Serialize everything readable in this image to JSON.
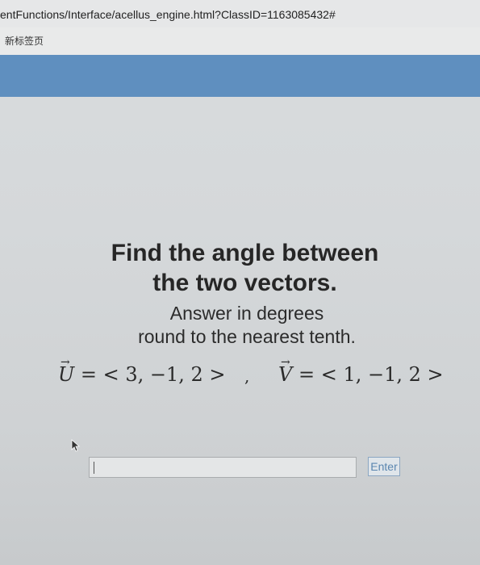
{
  "browser": {
    "url": "entFunctions/Interface/acellus_engine.html?ClassID=1163085432#",
    "bookmark": "新标签页"
  },
  "colors": {
    "header_band": "#5f8fbf",
    "enter_text": "#5a86b0"
  },
  "question": {
    "title_line1": "Find the angle between",
    "title_line2": "the two vectors.",
    "instruction_line1": "Answer in degrees",
    "instruction_line2": "round to the nearest tenth.",
    "vector_u": {
      "symbol": "U",
      "arrow": "→",
      "equals": " = ",
      "value": "< 3, −1, 2 >"
    },
    "separator": ",",
    "vector_v": {
      "symbol": "V",
      "arrow": "→",
      "equals": " = ",
      "value": "< 1, −1, 2 >"
    }
  },
  "answer": {
    "value": "",
    "placeholder": ""
  },
  "enter_label": "Enter",
  "icons": {
    "cursor": "mouse-pointer-icon"
  }
}
